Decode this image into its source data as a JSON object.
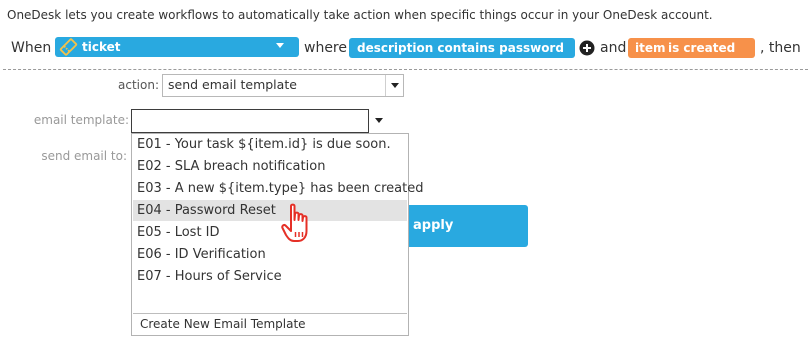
{
  "intro": "OneDesk lets you create workflows to automatically take action when specific things occur in your OneDesk account.",
  "rule": {
    "when": "When",
    "trigger_type": "ticket",
    "where": "where",
    "condition": "description contains password",
    "and": "and",
    "item_label": "item",
    "item_event": "is created",
    "then": ", then"
  },
  "action": {
    "label": "action:",
    "value": "send email template"
  },
  "email_template": {
    "label": "email template:",
    "value": ""
  },
  "send_email": {
    "label": "send email to:"
  },
  "apply_label": "apply",
  "dropdown": {
    "options": [
      "E01 - Your task ${item.id} is due soon.",
      "E02 - SLA breach notification",
      "E03 - A new ${item.type} has been created",
      "E04 - Password Reset",
      "E05 - Lost ID",
      "E06 - ID Verification",
      "E07 - Hours of Service"
    ],
    "highlighted": "E04 - Password Reset",
    "create_label": "Create New Email Template"
  },
  "colors": {
    "accent_blue": "#29a9e0",
    "accent_orange": "#f7914a",
    "cursor_red": "#e53027"
  },
  "icons": {
    "trigger": "ticket-icon",
    "add_condition": "plus-circle-icon",
    "cursor": "hand-pointer-icon"
  }
}
